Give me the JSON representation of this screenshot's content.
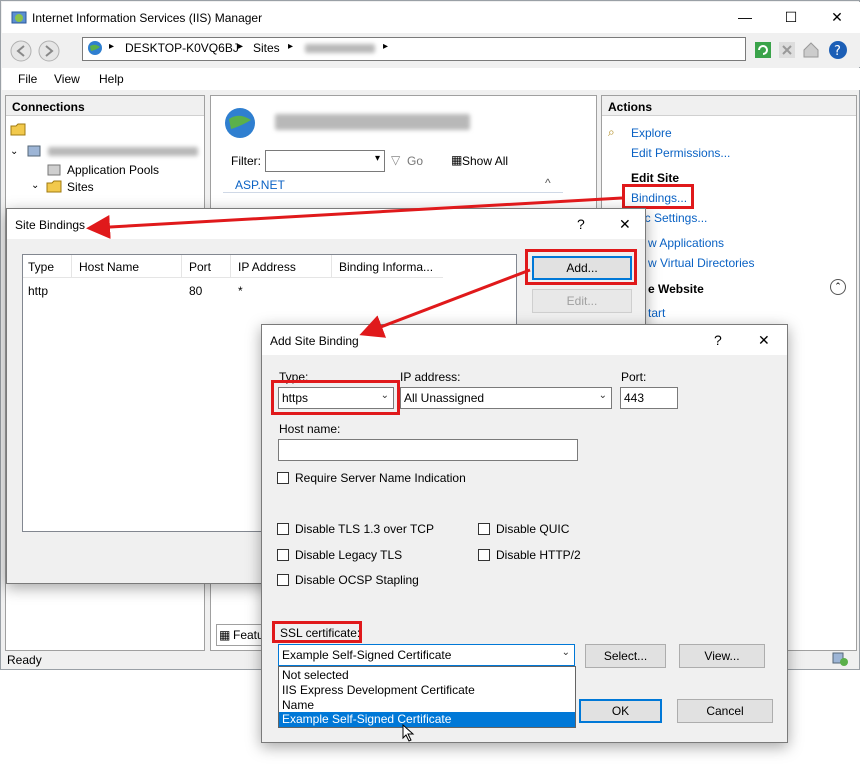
{
  "window": {
    "title": "Internet Information Services (IIS) Manager",
    "controls": {
      "minimize": "—",
      "maximize": "☐",
      "close": "✕"
    }
  },
  "address": {
    "crumbs": [
      "DESKTOP-K0VQ6BJ",
      "Sites"
    ]
  },
  "menu": [
    "File",
    "View",
    "Help"
  ],
  "connections": {
    "header": "Connections",
    "items": [
      "Application Pools",
      "Sites"
    ]
  },
  "center": {
    "filter_label": "Filter:",
    "go_label": "Go",
    "show_all_label": "Show All",
    "group_label": "ASP.NET",
    "features_tab": "Featu"
  },
  "actions": {
    "header": "Actions",
    "explore": "Explore",
    "edit_permissions": "Edit Permissions...",
    "edit_site": "Edit Site",
    "bindings": "Bindings...",
    "basic_settings_partial": "ic Settings...",
    "view_applications_partial": "w Applications",
    "view_vdirs_partial": "w Virtual Directories",
    "manage_website_partial": "e Website",
    "start_partial": "tart"
  },
  "status": {
    "text": "Ready"
  },
  "site_bindings": {
    "title": "Site Bindings",
    "help": "?",
    "close": "✕",
    "columns": [
      "Type",
      "Host Name",
      "Port",
      "IP Address",
      "Binding Informa..."
    ],
    "rows": [
      {
        "type": "http",
        "host": "",
        "port": "80",
        "ip": "*",
        "info": ""
      }
    ],
    "add_button": "Add...",
    "edit_button": "Edit..."
  },
  "add_binding": {
    "title": "Add Site Binding",
    "help": "?",
    "close": "✕",
    "type_label": "Type:",
    "type_value": "https",
    "ip_label": "IP address:",
    "ip_value": "All Unassigned",
    "port_label": "Port:",
    "port_value": "443",
    "host_label": "Host name:",
    "host_value": "",
    "require_sni": "Require Server Name Indication",
    "disable_tls13": "Disable TLS 1.3 over TCP",
    "disable_quic": "Disable QUIC",
    "disable_legacy_tls": "Disable Legacy TLS",
    "disable_http2": "Disable HTTP/2",
    "disable_ocsp": "Disable OCSP Stapling",
    "ssl_label": "SSL certificate:",
    "ssl_value": "Example Self-Signed Certificate",
    "ssl_options": [
      "Not selected",
      "IIS Express Development Certificate",
      "Name",
      "Example Self-Signed Certificate"
    ],
    "select_button": "Select...",
    "view_button": "View...",
    "ok_button": "OK",
    "cancel_button": "Cancel"
  },
  "colors": {
    "highlight": "#e0191b",
    "selection": "#0078d7",
    "link": "#0a62c4"
  }
}
